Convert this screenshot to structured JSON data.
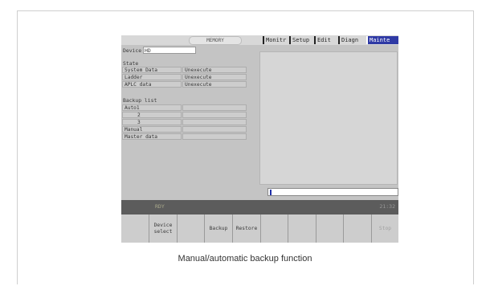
{
  "topbar": {
    "mode": "MEMORY",
    "tabs": [
      "Monitr",
      "Setup",
      "Edit",
      "Diagn",
      "Mainte"
    ],
    "active_tab": "Mainte"
  },
  "device": {
    "label": "Device",
    "value": "HD"
  },
  "state": {
    "heading": "State",
    "rows": [
      {
        "name": "System Data",
        "value": "Unexecute"
      },
      {
        "name": "Ladder",
        "value": "Unexecute"
      },
      {
        "name": "APLC data",
        "value": "Unexecute"
      }
    ]
  },
  "backup_list": {
    "heading": "Backup list",
    "rows": [
      {
        "name": "Auto1",
        "value": ""
      },
      {
        "name": "2",
        "value": ""
      },
      {
        "name": "3",
        "value": ""
      },
      {
        "name": "Manual",
        "value": ""
      },
      {
        "name": "Master data",
        "value": ""
      }
    ]
  },
  "status": {
    "left": "RDY",
    "time": "21:32"
  },
  "function_keys": [
    "",
    "Device\nselect",
    "",
    "Backup",
    "Restore",
    "",
    "",
    "",
    "",
    "Stop"
  ],
  "caption": "Manual/automatic backup function",
  "colors": {
    "active_tab_bg": "#2f3aa5",
    "status_bar": "#5c5c5c",
    "cursor": "#1f2fa8"
  }
}
